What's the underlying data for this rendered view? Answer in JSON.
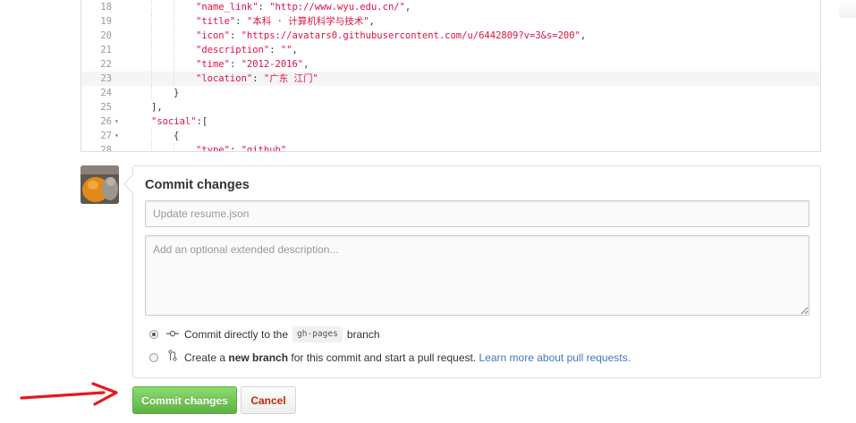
{
  "editor": {
    "lines": [
      {
        "num": "18",
        "fold": "",
        "indent": 3,
        "key": "\"name_link\"",
        "sep": ": ",
        "value": "\"http://www.wyu.edu.cn/\"",
        "tail": ","
      },
      {
        "num": "19",
        "fold": "",
        "indent": 3,
        "key": "\"title\"",
        "sep": ": ",
        "value": "\"本科 · 计算机科学与技术\"",
        "tail": ","
      },
      {
        "num": "20",
        "fold": "",
        "indent": 3,
        "key": "\"icon\"",
        "sep": ": ",
        "value": "\"https://avatars0.githubusercontent.com/u/6442809?v=3&s=200\"",
        "tail": ","
      },
      {
        "num": "21",
        "fold": "",
        "indent": 3,
        "key": "\"description\"",
        "sep": ": ",
        "value": "\"\"",
        "tail": ","
      },
      {
        "num": "22",
        "fold": "",
        "indent": 3,
        "key": "\"time\"",
        "sep": ": ",
        "value": "\"2012-2016\"",
        "tail": ","
      },
      {
        "num": "23",
        "fold": "",
        "indent": 3,
        "key": "\"location\"",
        "sep": ": ",
        "value": "\"广东 江门\"",
        "tail": ""
      },
      {
        "num": "24",
        "fold": "",
        "indent": 2,
        "key": "",
        "sep": "",
        "value": "",
        "tail": "}"
      },
      {
        "num": "25",
        "fold": "",
        "indent": 1,
        "key": "",
        "sep": "",
        "value": "",
        "tail": "],"
      },
      {
        "num": "26",
        "fold": "▾",
        "indent": 1,
        "key": "\"social\"",
        "sep": ":",
        "value": "",
        "tail": "["
      },
      {
        "num": "27",
        "fold": "▾",
        "indent": 2,
        "key": "",
        "sep": "",
        "value": "",
        "tail": "{"
      },
      {
        "num": "28",
        "fold": "",
        "indent": 3,
        "key": "\"type\"",
        "sep": ": ",
        "value": "\"github\"",
        "tail": ","
      }
    ],
    "active_line": "23"
  },
  "commit": {
    "title": "Commit changes",
    "summary_placeholder": "Update resume.json",
    "description_placeholder": "Add an optional extended description...",
    "option_direct": {
      "prefix": "Commit directly to the",
      "branch": "gh-pages",
      "suffix": "branch",
      "icon": "git-commit-icon",
      "checked": true
    },
    "option_new_branch": {
      "prefix": "Create a",
      "bold": "new branch",
      "middle": "for this commit and start a pull request.",
      "link": "Learn more about pull requests.",
      "icon": "git-pull-request-icon",
      "checked": false
    }
  },
  "buttons": {
    "commit_label": "Commit changes",
    "cancel_label": "Cancel"
  },
  "colors": {
    "commit_green": "#60b044",
    "cancel_red": "#bd2c00",
    "link_blue": "#4078c0",
    "annotation_arrow": "#e8171f",
    "code_string": "#dd1144"
  }
}
